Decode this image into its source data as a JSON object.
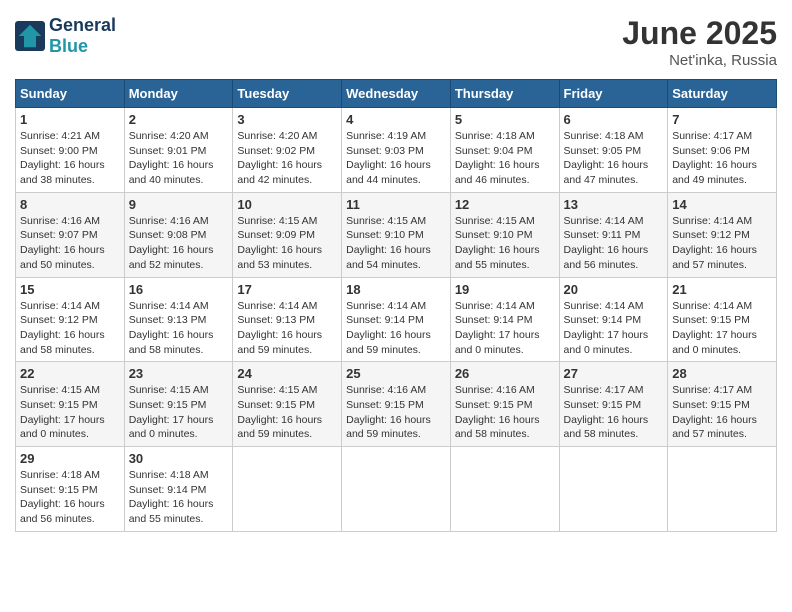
{
  "header": {
    "logo_line1": "General",
    "logo_line2": "Blue",
    "month_year": "June 2025",
    "location": "Net'inka, Russia"
  },
  "columns": [
    "Sunday",
    "Monday",
    "Tuesday",
    "Wednesday",
    "Thursday",
    "Friday",
    "Saturday"
  ],
  "weeks": [
    [
      {
        "day": "1",
        "sunrise": "Sunrise: 4:21 AM",
        "sunset": "Sunset: 9:00 PM",
        "daylight": "Daylight: 16 hours and 38 minutes."
      },
      {
        "day": "2",
        "sunrise": "Sunrise: 4:20 AM",
        "sunset": "Sunset: 9:01 PM",
        "daylight": "Daylight: 16 hours and 40 minutes."
      },
      {
        "day": "3",
        "sunrise": "Sunrise: 4:20 AM",
        "sunset": "Sunset: 9:02 PM",
        "daylight": "Daylight: 16 hours and 42 minutes."
      },
      {
        "day": "4",
        "sunrise": "Sunrise: 4:19 AM",
        "sunset": "Sunset: 9:03 PM",
        "daylight": "Daylight: 16 hours and 44 minutes."
      },
      {
        "day": "5",
        "sunrise": "Sunrise: 4:18 AM",
        "sunset": "Sunset: 9:04 PM",
        "daylight": "Daylight: 16 hours and 46 minutes."
      },
      {
        "day": "6",
        "sunrise": "Sunrise: 4:18 AM",
        "sunset": "Sunset: 9:05 PM",
        "daylight": "Daylight: 16 hours and 47 minutes."
      },
      {
        "day": "7",
        "sunrise": "Sunrise: 4:17 AM",
        "sunset": "Sunset: 9:06 PM",
        "daylight": "Daylight: 16 hours and 49 minutes."
      }
    ],
    [
      {
        "day": "8",
        "sunrise": "Sunrise: 4:16 AM",
        "sunset": "Sunset: 9:07 PM",
        "daylight": "Daylight: 16 hours and 50 minutes."
      },
      {
        "day": "9",
        "sunrise": "Sunrise: 4:16 AM",
        "sunset": "Sunset: 9:08 PM",
        "daylight": "Daylight: 16 hours and 52 minutes."
      },
      {
        "day": "10",
        "sunrise": "Sunrise: 4:15 AM",
        "sunset": "Sunset: 9:09 PM",
        "daylight": "Daylight: 16 hours and 53 minutes."
      },
      {
        "day": "11",
        "sunrise": "Sunrise: 4:15 AM",
        "sunset": "Sunset: 9:10 PM",
        "daylight": "Daylight: 16 hours and 54 minutes."
      },
      {
        "day": "12",
        "sunrise": "Sunrise: 4:15 AM",
        "sunset": "Sunset: 9:10 PM",
        "daylight": "Daylight: 16 hours and 55 minutes."
      },
      {
        "day": "13",
        "sunrise": "Sunrise: 4:14 AM",
        "sunset": "Sunset: 9:11 PM",
        "daylight": "Daylight: 16 hours and 56 minutes."
      },
      {
        "day": "14",
        "sunrise": "Sunrise: 4:14 AM",
        "sunset": "Sunset: 9:12 PM",
        "daylight": "Daylight: 16 hours and 57 minutes."
      }
    ],
    [
      {
        "day": "15",
        "sunrise": "Sunrise: 4:14 AM",
        "sunset": "Sunset: 9:12 PM",
        "daylight": "Daylight: 16 hours and 58 minutes."
      },
      {
        "day": "16",
        "sunrise": "Sunrise: 4:14 AM",
        "sunset": "Sunset: 9:13 PM",
        "daylight": "Daylight: 16 hours and 58 minutes."
      },
      {
        "day": "17",
        "sunrise": "Sunrise: 4:14 AM",
        "sunset": "Sunset: 9:13 PM",
        "daylight": "Daylight: 16 hours and 59 minutes."
      },
      {
        "day": "18",
        "sunrise": "Sunrise: 4:14 AM",
        "sunset": "Sunset: 9:14 PM",
        "daylight": "Daylight: 16 hours and 59 minutes."
      },
      {
        "day": "19",
        "sunrise": "Sunrise: 4:14 AM",
        "sunset": "Sunset: 9:14 PM",
        "daylight": "Daylight: 17 hours and 0 minutes."
      },
      {
        "day": "20",
        "sunrise": "Sunrise: 4:14 AM",
        "sunset": "Sunset: 9:14 PM",
        "daylight": "Daylight: 17 hours and 0 minutes."
      },
      {
        "day": "21",
        "sunrise": "Sunrise: 4:14 AM",
        "sunset": "Sunset: 9:15 PM",
        "daylight": "Daylight: 17 hours and 0 minutes."
      }
    ],
    [
      {
        "day": "22",
        "sunrise": "Sunrise: 4:15 AM",
        "sunset": "Sunset: 9:15 PM",
        "daylight": "Daylight: 17 hours and 0 minutes."
      },
      {
        "day": "23",
        "sunrise": "Sunrise: 4:15 AM",
        "sunset": "Sunset: 9:15 PM",
        "daylight": "Daylight: 17 hours and 0 minutes."
      },
      {
        "day": "24",
        "sunrise": "Sunrise: 4:15 AM",
        "sunset": "Sunset: 9:15 PM",
        "daylight": "Daylight: 16 hours and 59 minutes."
      },
      {
        "day": "25",
        "sunrise": "Sunrise: 4:16 AM",
        "sunset": "Sunset: 9:15 PM",
        "daylight": "Daylight: 16 hours and 59 minutes."
      },
      {
        "day": "26",
        "sunrise": "Sunrise: 4:16 AM",
        "sunset": "Sunset: 9:15 PM",
        "daylight": "Daylight: 16 hours and 58 minutes."
      },
      {
        "day": "27",
        "sunrise": "Sunrise: 4:17 AM",
        "sunset": "Sunset: 9:15 PM",
        "daylight": "Daylight: 16 hours and 58 minutes."
      },
      {
        "day": "28",
        "sunrise": "Sunrise: 4:17 AM",
        "sunset": "Sunset: 9:15 PM",
        "daylight": "Daylight: 16 hours and 57 minutes."
      }
    ],
    [
      {
        "day": "29",
        "sunrise": "Sunrise: 4:18 AM",
        "sunset": "Sunset: 9:15 PM",
        "daylight": "Daylight: 16 hours and 56 minutes."
      },
      {
        "day": "30",
        "sunrise": "Sunrise: 4:18 AM",
        "sunset": "Sunset: 9:14 PM",
        "daylight": "Daylight: 16 hours and 55 minutes."
      },
      null,
      null,
      null,
      null,
      null
    ]
  ]
}
